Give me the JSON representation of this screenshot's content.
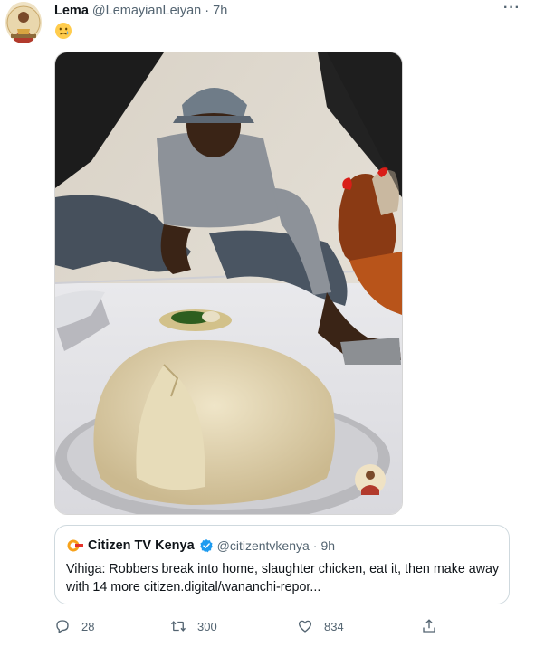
{
  "tweet": {
    "author_name": "Lema",
    "author_handle": "@LemayianLeiyan",
    "separator": "·",
    "time": "7h",
    "more_label": "···",
    "emoji": "😢"
  },
  "quote": {
    "name": "Citizen TV Kenya",
    "handle": "@citizentvkenya",
    "separator": "·",
    "time": "9h",
    "text": "Vihiga: Robbers break into home, slaughter chicken, eat it, then make away with 14 more citizen.digital/wananchi-repor..."
  },
  "actions": {
    "reply_count": "28",
    "retweet_count": "300",
    "like_count": "834"
  },
  "colors": {
    "text_primary": "#0f1419",
    "text_secondary": "#536471",
    "verified": "#1d9bf0",
    "border": "#cfd9de"
  },
  "icons": [
    "avatar",
    "more-icon",
    "verified-icon",
    "reply-icon",
    "retweet-icon",
    "like-icon",
    "share-icon"
  ]
}
